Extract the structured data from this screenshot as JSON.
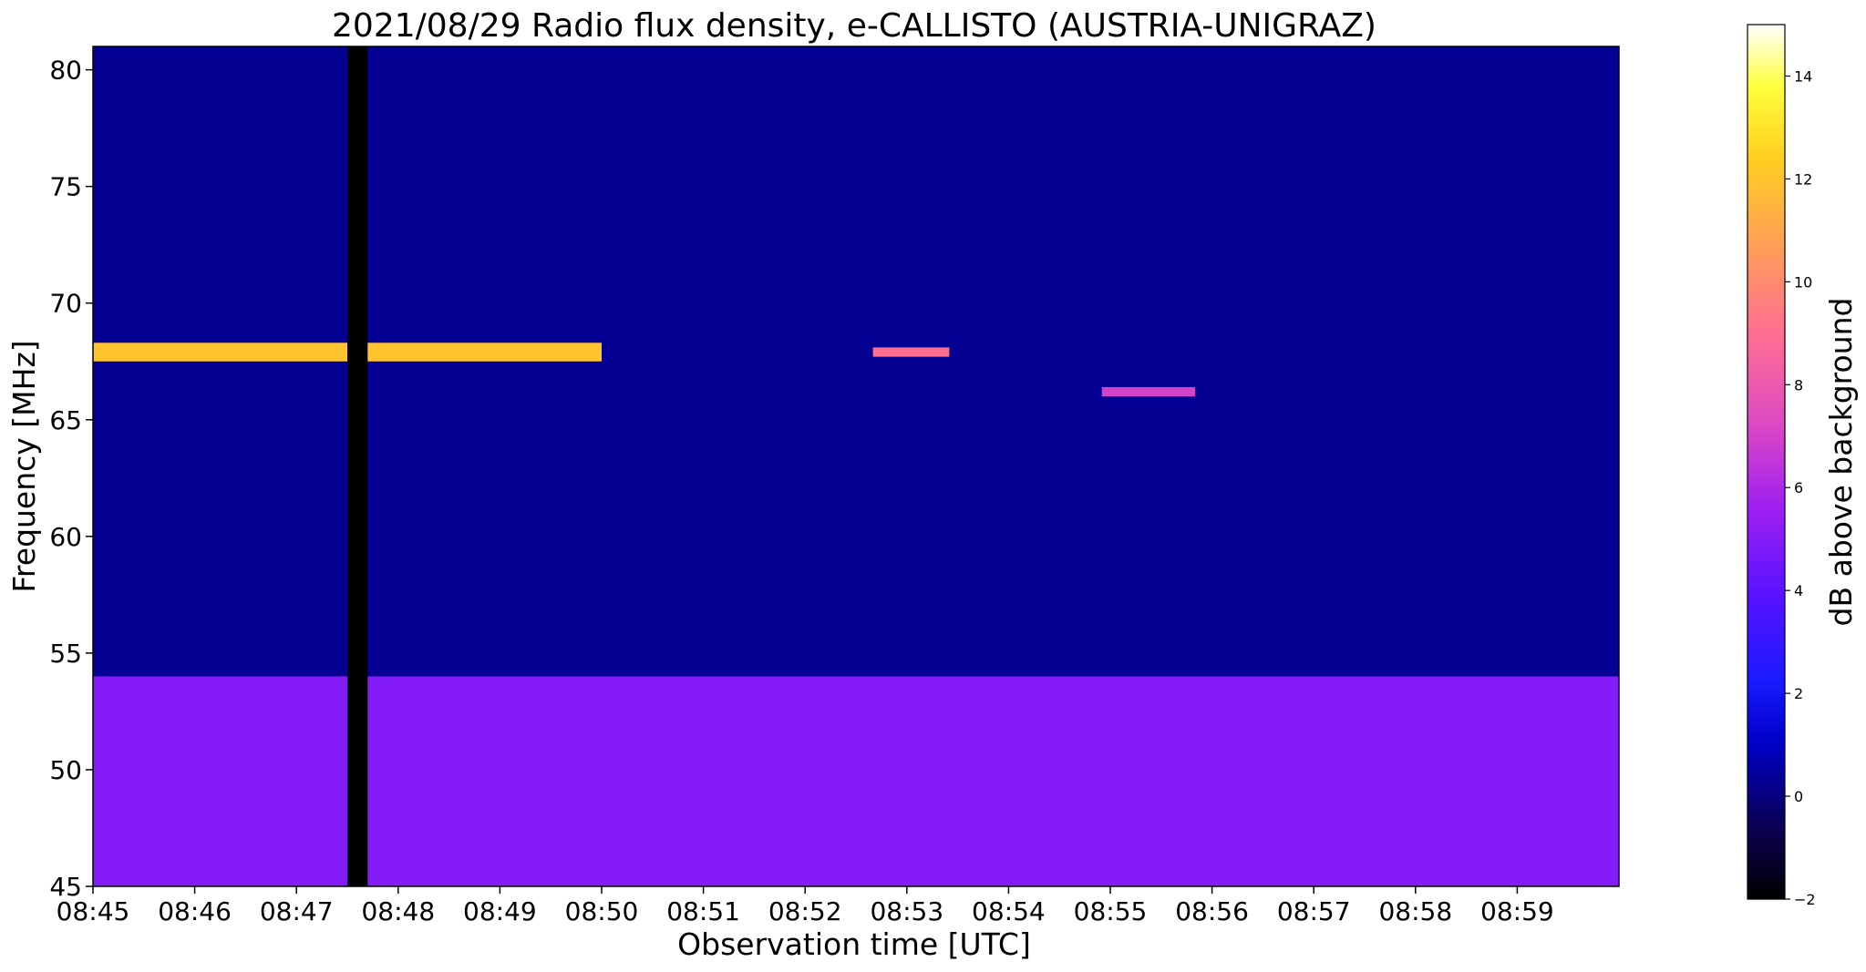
{
  "chart_data": {
    "type": "heatmap",
    "title": "2021/08/29  Radio flux density, e-CALLISTO (AUSTRIA-UNIGRAZ)",
    "xlabel": "Observation time [UTC]",
    "ylabel": "Frequency [MHz]",
    "colorbar_label": "dB above background",
    "colormap": "gnuplot2",
    "x_range": [
      "08:45",
      "09:00"
    ],
    "y_range": [
      45,
      81
    ],
    "clim": [
      -2,
      15
    ],
    "x_ticks": [
      "08:45",
      "08:46",
      "08:47",
      "08:48",
      "08:49",
      "08:50",
      "08:51",
      "08:52",
      "08:53",
      "08:54",
      "08:55",
      "08:56",
      "08:57",
      "08:58",
      "08:59"
    ],
    "y_ticks": [
      45,
      50,
      55,
      60,
      65,
      70,
      75,
      80
    ],
    "colorbar_ticks": [
      -2,
      0,
      2,
      4,
      6,
      8,
      10,
      12,
      14
    ],
    "features": [
      {
        "description": "bright burst band",
        "time_start": "08:45",
        "time_end": "08:50",
        "freq_low": 67.5,
        "freq_high": 68.3,
        "level_db": 12
      },
      {
        "description": "bright patch",
        "time_start": "08:52:40",
        "time_end": "08:53:25",
        "freq_low": 67.7,
        "freq_high": 68.1,
        "level_db": 9
      },
      {
        "description": "pink patch",
        "time_start": "08:54:55",
        "time_end": "08:55:50",
        "freq_low": 66.0,
        "freq_high": 66.4,
        "level_db": 7
      },
      {
        "description": "elevated band",
        "time_start": "08:45",
        "time_end": "09:00",
        "freq_low": 45,
        "freq_high": 54,
        "level_db": 5
      },
      {
        "description": "dropout column",
        "time_start": "08:47:30",
        "time_end": "08:47:42",
        "freq_low": 45,
        "freq_high": 81,
        "level_db": -2
      }
    ]
  }
}
